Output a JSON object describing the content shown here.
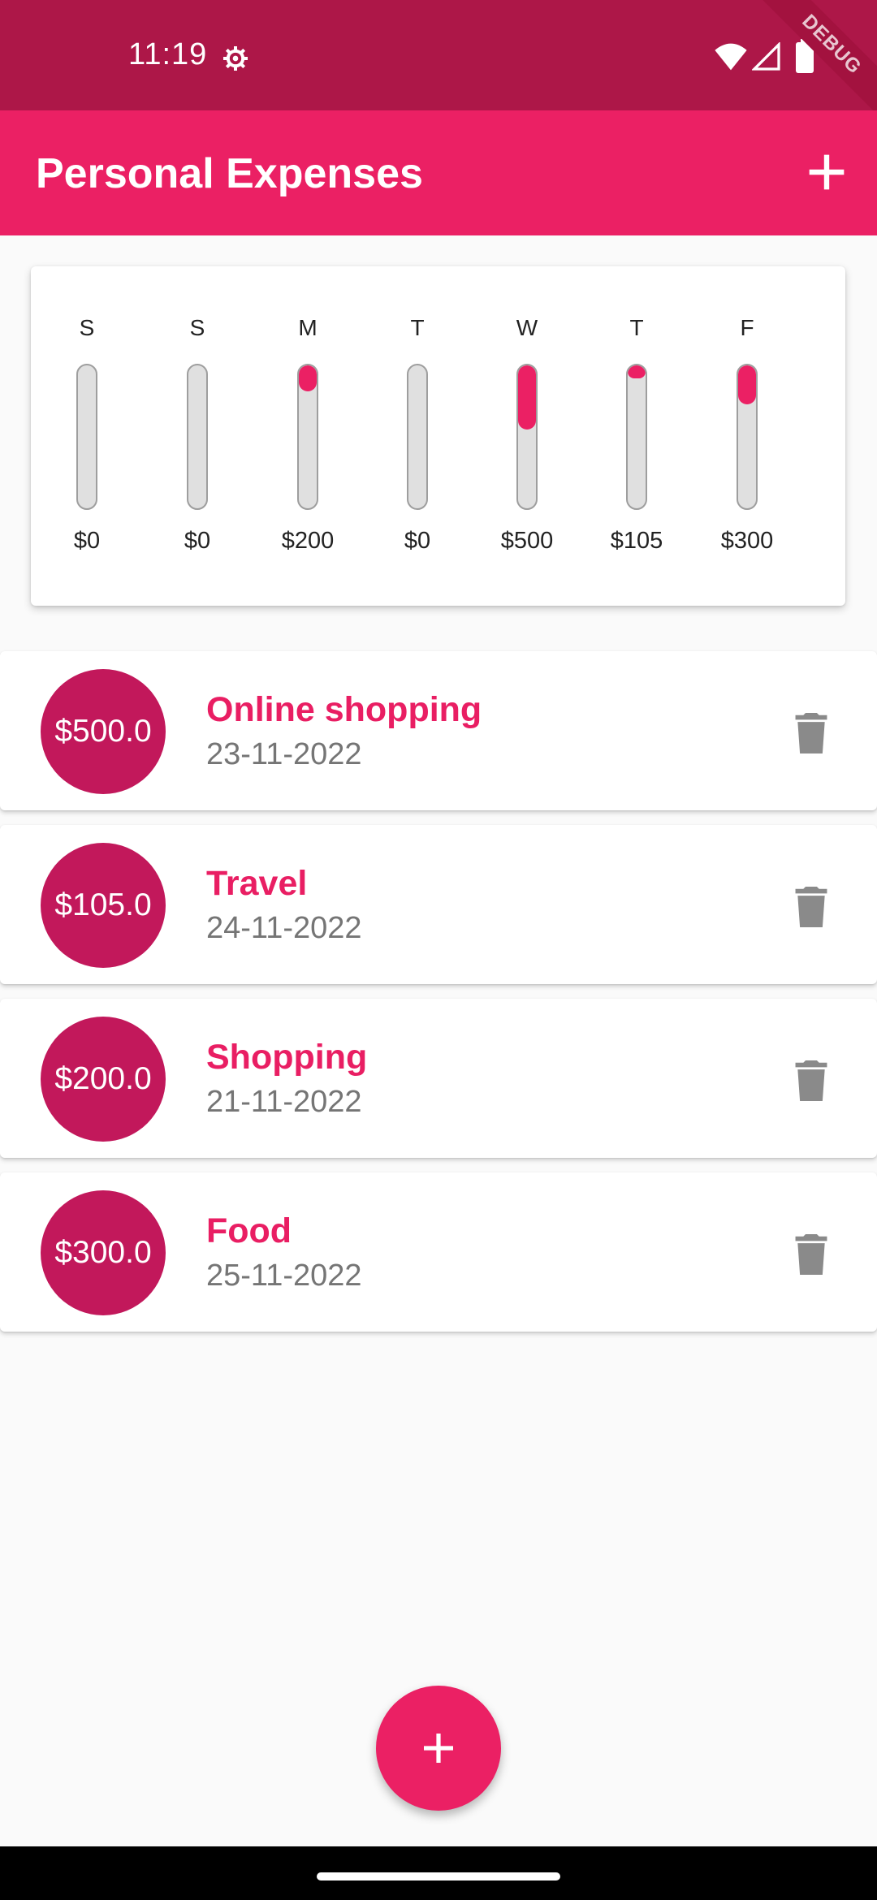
{
  "status_bar": {
    "time": "11:19",
    "icons": [
      "gear-icon",
      "wifi-icon",
      "signal-icon",
      "battery-icon"
    ],
    "debug_label": "DEBUG"
  },
  "app_bar": {
    "title": "Personal Expenses",
    "add_icon": "plus-icon"
  },
  "chart": {
    "bars": [
      {
        "day": "S",
        "amount": "$0",
        "fill_fraction": 0.0
      },
      {
        "day": "S",
        "amount": "$0",
        "fill_fraction": 0.0
      },
      {
        "day": "M",
        "amount": "$200",
        "fill_fraction": 0.18
      },
      {
        "day": "T",
        "amount": "$0",
        "fill_fraction": 0.0
      },
      {
        "day": "W",
        "amount": "$500",
        "fill_fraction": 0.45
      },
      {
        "day": "T",
        "amount": "$105",
        "fill_fraction": 0.09
      },
      {
        "day": "F",
        "amount": "$300",
        "fill_fraction": 0.27
      }
    ]
  },
  "transactions": [
    {
      "amount": "$500.0",
      "title": "Online shopping",
      "date": "23-11-2022"
    },
    {
      "amount": "$105.0",
      "title": "Travel",
      "date": "24-11-2022"
    },
    {
      "amount": "$200.0",
      "title": "Shopping",
      "date": "21-11-2022"
    },
    {
      "amount": "$300.0",
      "title": "Food",
      "date": "25-11-2022"
    }
  ],
  "fab": {
    "icon": "plus-icon"
  },
  "colors": {
    "status_bar": "#ad1748",
    "primary": "#eb2064",
    "avatar": "#c2185b",
    "title_text": "#e91e63",
    "delete_icon": "#8a8a8a"
  }
}
